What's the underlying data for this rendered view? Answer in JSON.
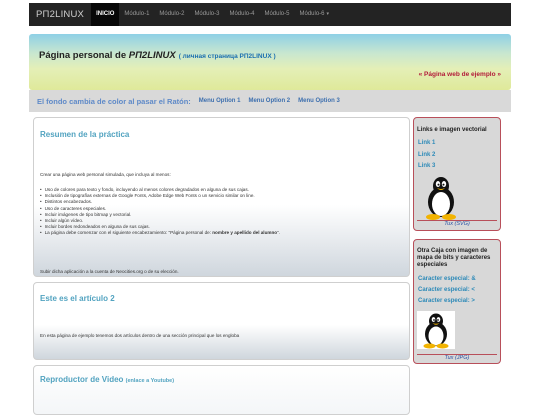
{
  "navbar": {
    "brand": "PΠ2LINUX",
    "items": [
      {
        "label": "INICIO",
        "active": true
      },
      {
        "label": "Módulo-1"
      },
      {
        "label": "Módulo-2"
      },
      {
        "label": "Módulo-3"
      },
      {
        "label": "Módulo-4"
      },
      {
        "label": "Módulo-5"
      },
      {
        "label": "Módulo-6"
      }
    ],
    "dropdown_caret": "▾"
  },
  "header": {
    "title_prefix": "Página personal de ",
    "title_brand": "PΠ2LINUX",
    "title_sub": "( личная страница PΠ2LINUX )",
    "example_link": "« Página web de ejemplo »"
  },
  "menubar": {
    "text": "El fondo cambia de color al pasar el Ratón:",
    "options": [
      "Menu Option 1",
      "Menu Option 2",
      "Menu Option 3"
    ]
  },
  "articles": {
    "a1": {
      "title": "Resumen de la práctica",
      "intro": "Crear una página web personal simulada, que incluya al menos:",
      "items": [
        "Uso de colores para texto y fondo, incluyendo al menos colores degradados en alguna de sus cajas.",
        "Inclusión de tipografías externas de Google Fonts, Adobe Edge Web Fonts o un servicio similar on line.",
        "Distintos encabezados.",
        "Uso de caracteres especiales.",
        "Incluir imágenes de tipo bitmap y vectorial.",
        "Incluir algún vídeo.",
        "Incluir bordes redondeados en alguna de sus cajas."
      ],
      "last_item_prefix": "La página debe comenzar con el siguiente encabezamiento: \"Página personal de: ",
      "last_item_bold": "nombre y apellido del alumno",
      "last_item_suffix": "\".",
      "footer": "Subir dicha aplicación a la cuenta de Neocities.org o de su elección."
    },
    "a2": {
      "title": "Este es el artículo 2",
      "text": "En esta página de ejemplo tenemos dos artículos dentro de una sección principal que los engloba"
    },
    "a3": {
      "title": "Reproductor de Video",
      "title_small": "(enlace a Youtube)"
    }
  },
  "aside1": {
    "title": "Links e imagen vectorial",
    "links": [
      "Link 1",
      "Link 2",
      "Link 3"
    ],
    "caption": "Tux (SVG)"
  },
  "aside2": {
    "title": "Otra Caja con imagen de mapa de bits y caracteres especiales",
    "links": [
      "Caracter especial: &",
      "Caracter especial: <",
      "Caracter especial: >"
    ],
    "caption": "Tux (JPG)"
  },
  "colors": {
    "navbar_bg": "#232323",
    "header_gradient_top": "#8fd0e6",
    "header_gradient_bottom": "#dfe99a",
    "accent_title": "#52a3c0",
    "aside_border": "#b84f5a",
    "example_link": "#b21a38"
  }
}
